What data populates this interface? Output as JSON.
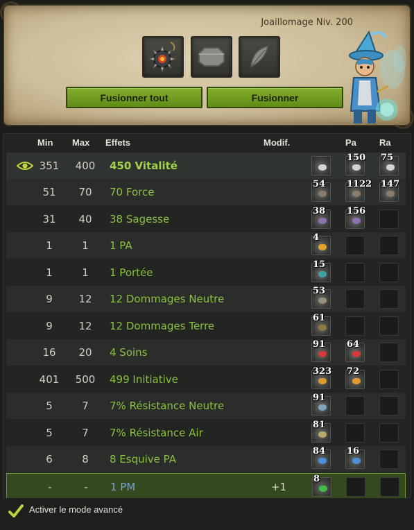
{
  "header": {
    "profession": "Joaillomage Niv. 200",
    "slots": [
      "item-slot",
      "rune-slot-empty",
      "feather-slot"
    ],
    "buttons": {
      "fuse_all": "Fusionner tout",
      "fuse": "Fusionner"
    }
  },
  "table": {
    "columns": {
      "min": "Min",
      "max": "Max",
      "effects": "Effets",
      "modif": "Modif.",
      "pa": "Pa",
      "ra": "Ra"
    },
    "rows": [
      {
        "min": "351",
        "max": "400",
        "effect": "450 Vitalité",
        "modif": "",
        "runes": [
          "",
          "150",
          "75"
        ],
        "style": "bold"
      },
      {
        "min": "51",
        "max": "70",
        "effect": "70 Force",
        "modif": "",
        "runes": [
          "54",
          "1122",
          "147"
        ],
        "style": "normal"
      },
      {
        "min": "31",
        "max": "40",
        "effect": "38 Sagesse",
        "modif": "",
        "runes": [
          "38",
          "156",
          ""
        ],
        "style": "normal"
      },
      {
        "min": "1",
        "max": "1",
        "effect": "1 PA",
        "modif": "",
        "runes": [
          "4",
          "",
          ""
        ],
        "style": "normal"
      },
      {
        "min": "1",
        "max": "1",
        "effect": "1 Portée",
        "modif": "",
        "runes": [
          "15",
          "",
          ""
        ],
        "style": "normal"
      },
      {
        "min": "9",
        "max": "12",
        "effect": "12 Dommages Neutre",
        "modif": "",
        "runes": [
          "53",
          "",
          ""
        ],
        "style": "normal"
      },
      {
        "min": "9",
        "max": "12",
        "effect": "12 Dommages Terre",
        "modif": "",
        "runes": [
          "61",
          "",
          ""
        ],
        "style": "normal"
      },
      {
        "min": "16",
        "max": "20",
        "effect": "4 Soins",
        "modif": "",
        "runes": [
          "91",
          "64",
          ""
        ],
        "style": "normal"
      },
      {
        "min": "401",
        "max": "500",
        "effect": "499 Initiative",
        "modif": "",
        "runes": [
          "323",
          "72",
          ""
        ],
        "style": "normal"
      },
      {
        "min": "5",
        "max": "7",
        "effect": "7% Résistance Neutre",
        "modif": "",
        "runes": [
          "91",
          "",
          ""
        ],
        "style": "normal"
      },
      {
        "min": "5",
        "max": "7",
        "effect": "7% Résistance Air",
        "modif": "",
        "runes": [
          "81",
          "",
          ""
        ],
        "style": "normal"
      },
      {
        "min": "6",
        "max": "8",
        "effect": "8 Esquive PA",
        "modif": "",
        "runes": [
          "84",
          "16",
          ""
        ],
        "style": "normal"
      },
      {
        "min": "-",
        "max": "-",
        "effect": "1 PM",
        "modif": "+1",
        "runes": [
          "8",
          "",
          ""
        ],
        "style": "blue"
      }
    ]
  },
  "footer": {
    "advanced_mode_label": "Activer le mode avancé",
    "advanced_mode_checked": true
  },
  "colors": {
    "accent_green": "#6c9a2b",
    "effect_green": "#8cc13f",
    "blue_effect": "#7ba4d0"
  }
}
